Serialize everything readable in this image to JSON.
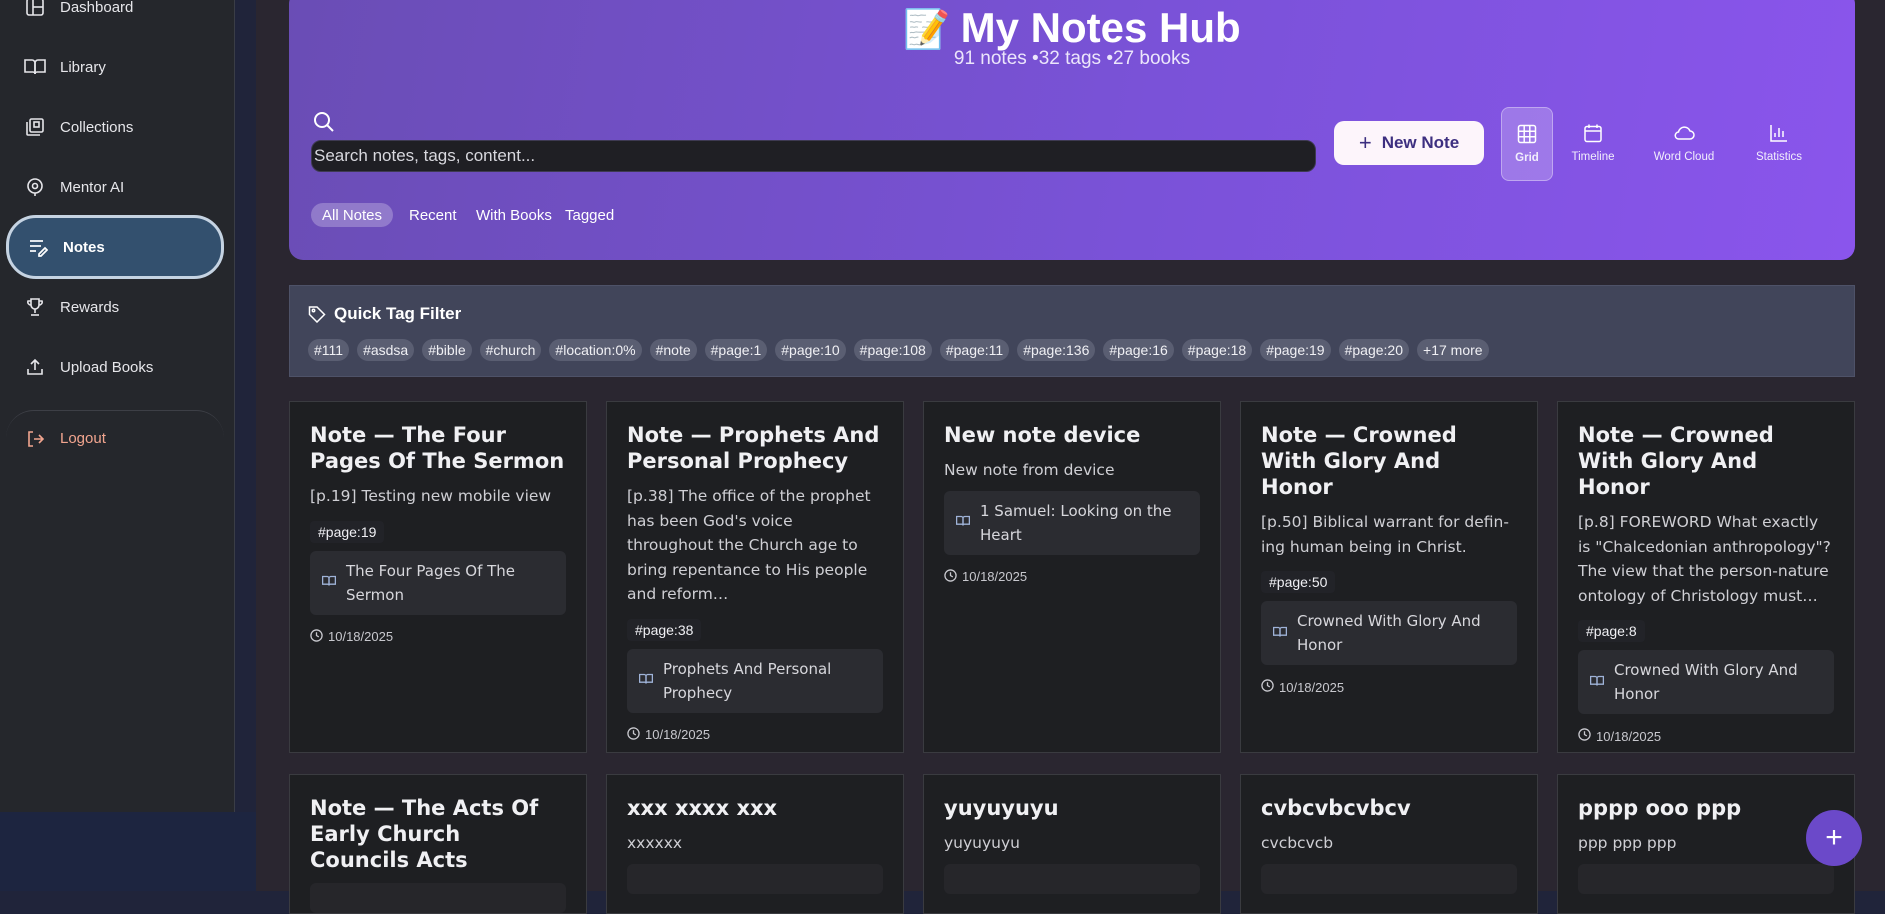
{
  "sidebar": {
    "items": [
      {
        "label": "Dashboard",
        "icon": "dashboard-icon"
      },
      {
        "label": "Library",
        "icon": "book-open-icon"
      },
      {
        "label": "Collections",
        "icon": "collections-icon"
      },
      {
        "label": "Mentor AI",
        "icon": "mentor-icon"
      },
      {
        "label": "Notes",
        "icon": "notes-icon",
        "active": true
      },
      {
        "label": "Rewards",
        "icon": "trophy-icon"
      },
      {
        "label": "Upload Books",
        "icon": "upload-icon"
      }
    ],
    "logout": "Logout"
  },
  "hero": {
    "emoji": "📝",
    "title": "My Notes Hub",
    "subtitle": "91 notes •32 tags •27 books",
    "search_placeholder": "Search notes, tags, content...",
    "new_note": "New Note",
    "views": [
      "Grid",
      "Timeline",
      "Word Cloud",
      "Statistics"
    ],
    "filters": [
      "All Notes",
      "Recent",
      "With Books",
      "Tagged"
    ]
  },
  "tag_filter": {
    "title": "Quick Tag Filter",
    "tags": [
      "#111",
      "#asdsa",
      "#bible",
      "#church",
      "#location:0%",
      "#note",
      "#page:1",
      "#page:10",
      "#page:108",
      "#page:11",
      "#page:136",
      "#page:16",
      "#page:18",
      "#page:19",
      "#page:20",
      "+17 more"
    ]
  },
  "notes": [
    {
      "title": "Note — The Four Pages Of The Sermon",
      "excerpt": "[p.19] Testing new mobile view",
      "tag": "#page:19",
      "book": "The Four Pages Of The Sermon",
      "date": "10/18/2025"
    },
    {
      "title": "Note — Prophets And Personal Prophecy",
      "excerpt": "[p.38] The office of the prophet has been God's voice throughout the Church age to bring repen­tance to His people and reform…",
      "tag": "#page:38",
      "book": "Prophets And Personal Prophecy",
      "date": "10/18/2025"
    },
    {
      "title": "New note device",
      "excerpt": "New note from device",
      "tag": "",
      "book": "1 Samuel: Looking on the Heart",
      "date": "10/18/2025"
    },
    {
      "title": "Note — Crowned With Glory And Honor",
      "excerpt": "[p.50] Biblical warrant for defin­ing human being in Christ.",
      "tag": "#page:50",
      "book": "Crowned With Glory And Honor",
      "date": "10/18/2025"
    },
    {
      "title": "Note — Crowned With Glory And Honor",
      "excerpt": "[p.8] FOREWORD What exactly is \"Chalcedonian anthropology\"? The view that the person-nature ontology of Christology must…",
      "tag": "#page:8",
      "book": "Crowned With Glory And Honor",
      "date": "10/18/2025"
    },
    {
      "title": "Note — The Acts Of Early Church Councils Acts",
      "excerpt": "",
      "tag": "",
      "book": "",
      "date": ""
    },
    {
      "title": "xxx xxxx xxx",
      "excerpt": "xxxxxx",
      "tag": "",
      "book": "",
      "date": ""
    },
    {
      "title": "yuyuyuyu",
      "excerpt": "yuyuyuyu",
      "tag": "",
      "book": "",
      "date": ""
    },
    {
      "title": "cvbcvbcvbcv",
      "excerpt": "cvcbcvcb",
      "tag": "",
      "book": "",
      "date": ""
    },
    {
      "title": "pppp ooo ppp",
      "excerpt": "ppp ppp ppp",
      "tag": "",
      "book": "",
      "date": ""
    }
  ],
  "fab": "+",
  "colors": {
    "accent": "#7a52d8",
    "active_nav": "#33506e",
    "logout": "#f2a58f"
  }
}
